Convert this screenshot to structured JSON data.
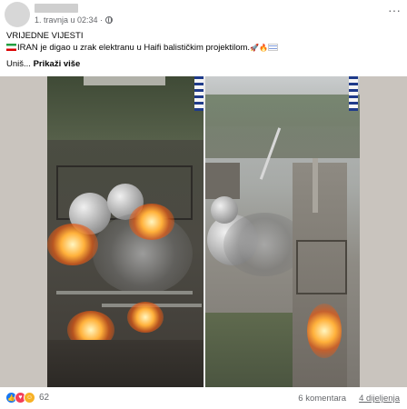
{
  "post": {
    "timestamp": "1. travnja u 02:34 ·",
    "more_icon": "more-horizontal-icon",
    "privacy_icon": "globe-icon",
    "text_line1": "VRIJEDNE VIJESTI",
    "text_line2": "IRAN je digao u zrak elektranu u Haifi balističkim projektilom.",
    "text_line2_emojis": "🚀🔥",
    "text_line3": "Uniš...",
    "see_more": "Prikaži više"
  },
  "media": {
    "accent_fire": "#ffb13b",
    "accent_flag_blue": "#1f3b8a"
  },
  "footer": {
    "reaction_icons": [
      "like-icon",
      "love-icon",
      "care-icon"
    ],
    "reaction_count": "62",
    "comments": "6 komentara",
    "shares": "4 dijeljenja"
  }
}
